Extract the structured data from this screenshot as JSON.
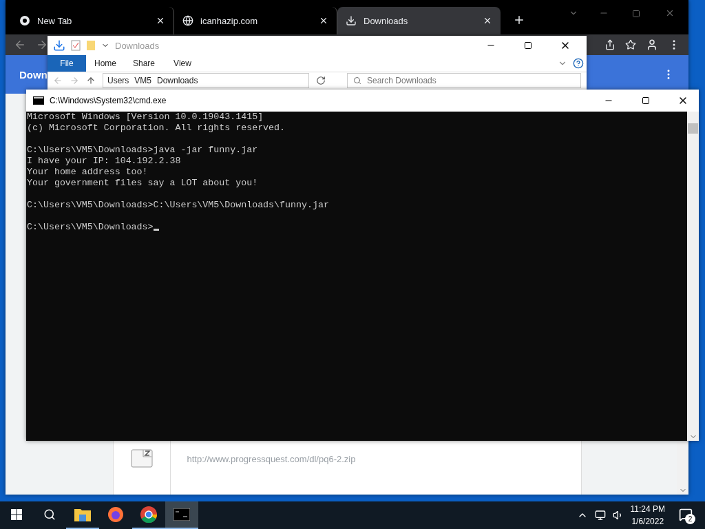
{
  "browser": {
    "tabs": [
      {
        "kind": "chrome",
        "title": "New Tab",
        "selected": false
      },
      {
        "kind": "site",
        "title": "icanhazip.com",
        "selected": false
      },
      {
        "kind": "download",
        "title": "Downloads",
        "selected": true
      }
    ],
    "page_title": "Down",
    "download": {
      "url": "http://www.progressquest.com/dl/pq6-2.zip"
    }
  },
  "explorer": {
    "title": "Downloads",
    "ribbon_tabs": [
      {
        "label": "File",
        "selected": true
      },
      {
        "label": "Home",
        "selected": false
      },
      {
        "label": "Share",
        "selected": false
      },
      {
        "label": "View",
        "selected": false
      }
    ],
    "path": [
      "Users",
      "VM5",
      "Downloads"
    ],
    "search": {
      "placeholder": "Search Downloads"
    }
  },
  "terminal": {
    "title": "C:\\Windows\\System32\\cmd.exe",
    "blocks": [
      [
        "Microsoft Windows [Version 10.0.19043.1415]",
        "(c) Microsoft Corporation. All rights reserved."
      ],
      [
        "C:\\Users\\VM5\\Downloads>java -jar funny.jar",
        "I have your IP: 104.192.2.38",
        "Your home address too!",
        "Your government files say a LOT about you!"
      ],
      [
        "C:\\Users\\VM5\\Downloads>C:\\Users\\VM5\\Downloads\\funny.jar"
      ],
      [
        "C:\\Users\\VM5\\Downloads>"
      ]
    ]
  },
  "taskbar": {
    "apps": [
      {
        "kind": "explorer",
        "running": true,
        "selected": false
      },
      {
        "kind": "firefox",
        "running": false,
        "selected": false
      },
      {
        "kind": "chrome",
        "running": true,
        "selected": false
      },
      {
        "kind": "terminal",
        "running": true,
        "selected": true
      }
    ],
    "time": "11:24 PM",
    "date": "1/6/2022",
    "notifications": "2"
  }
}
